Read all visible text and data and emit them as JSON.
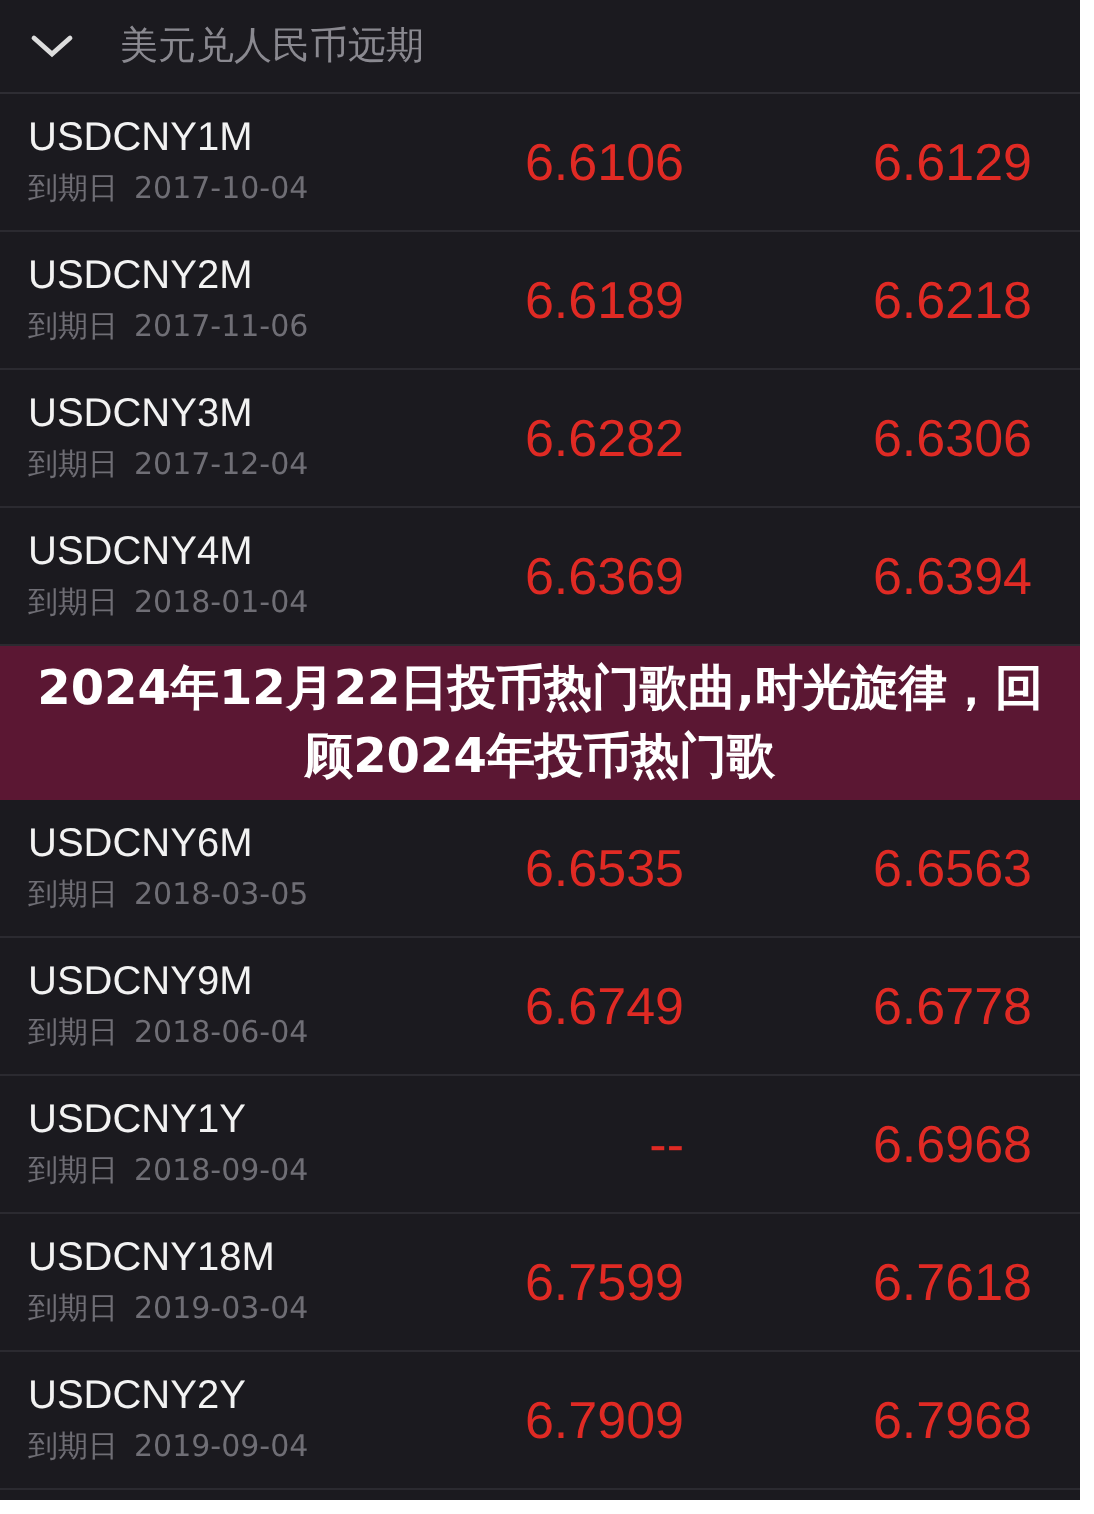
{
  "section": {
    "title": "美元兑人民币远期",
    "expanded": true
  },
  "rows_top": [
    {
      "name": "USDCNY1M",
      "maturity_label": "到期日",
      "maturity_date": "2017-10-04",
      "bid": "6.6106",
      "ask": "6.6129"
    },
    {
      "name": "USDCNY2M",
      "maturity_label": "到期日",
      "maturity_date": "2017-11-06",
      "bid": "6.6189",
      "ask": "6.6218"
    },
    {
      "name": "USDCNY3M",
      "maturity_label": "到期日",
      "maturity_date": "2017-12-04",
      "bid": "6.6282",
      "ask": "6.6306"
    },
    {
      "name": "USDCNY4M",
      "maturity_label": "到期日",
      "maturity_date": "2018-01-04",
      "bid": "6.6369",
      "ask": "6.6394"
    }
  ],
  "banner": {
    "title": "2024年12月22日投币热门歌曲,时光旋律，回顾2024年投币热门歌"
  },
  "rows_bottom": [
    {
      "name": "USDCNY6M",
      "maturity_label": "到期日",
      "maturity_date": "2018-03-05",
      "bid": "6.6535",
      "ask": "6.6563"
    },
    {
      "name": "USDCNY9M",
      "maturity_label": "到期日",
      "maturity_date": "2018-06-04",
      "bid": "6.6749",
      "ask": "6.6778"
    },
    {
      "name": "USDCNY1Y",
      "maturity_label": "到期日",
      "maturity_date": "2018-09-04",
      "bid": "--",
      "ask": "6.6968"
    },
    {
      "name": "USDCNY18M",
      "maturity_label": "到期日",
      "maturity_date": "2019-03-04",
      "bid": "6.7599",
      "ask": "6.7618"
    },
    {
      "name": "USDCNY2Y",
      "maturity_label": "到期日",
      "maturity_date": "2019-09-04",
      "bid": "6.7909",
      "ask": "6.7968"
    }
  ]
}
